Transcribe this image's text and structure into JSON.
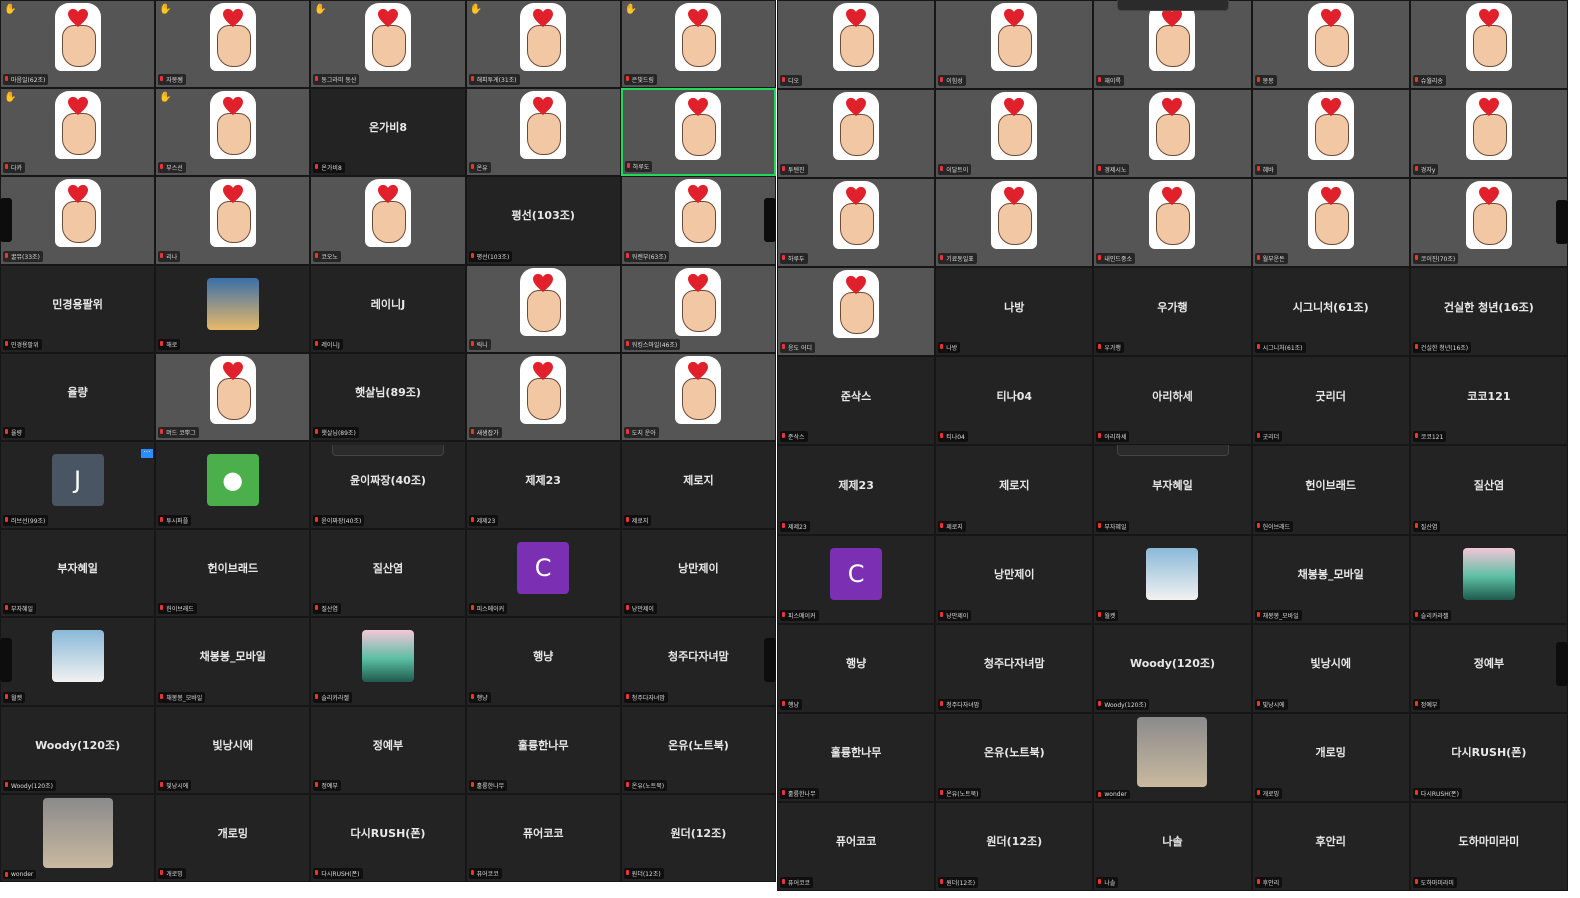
{
  "left_panel": {
    "tiles": [
      {
        "label": "마음일(62조)",
        "name": "",
        "video": true,
        "hand": true,
        "raised": true,
        "bg": "bg7"
      },
      {
        "label": "자몽쌤",
        "name": "",
        "video": true,
        "hand": true,
        "raised": true,
        "bg": "bg1"
      },
      {
        "label": "동그라미 동산",
        "name": "",
        "video": true,
        "hand": true,
        "raised": true,
        "bg": "bg7"
      },
      {
        "label": "해피투게(31조)",
        "name": "",
        "video": true,
        "hand": true,
        "raised": true,
        "bg": "bg2"
      },
      {
        "label": "은빛드림",
        "name": "",
        "video": true,
        "hand": true,
        "raised": true,
        "bg": "bg1"
      },
      {
        "label": "다카",
        "name": "",
        "video": true,
        "hand": true,
        "raised": true,
        "bg": "bg3"
      },
      {
        "label": "부스선",
        "name": "",
        "video": true,
        "hand": true,
        "raised": true,
        "bg": "bg3"
      },
      {
        "label": "온가비8",
        "name": "온가비8",
        "video": false
      },
      {
        "label": "온유",
        "name": "",
        "video": true,
        "hand": true,
        "bg": "bg7"
      },
      {
        "label": "하루도",
        "name": "",
        "video": true,
        "hand": true,
        "bg": "bg1",
        "active": true
      },
      {
        "label": "꿀뮤(33조)",
        "name": "",
        "video": true,
        "hand": true,
        "bg": "bg7"
      },
      {
        "label": "리나",
        "name": "",
        "video": true,
        "hand": true,
        "bg": "bg1"
      },
      {
        "label": "코오노",
        "name": "",
        "video": true,
        "hand": true,
        "bg": "bg7"
      },
      {
        "label": "평선(103조)",
        "name": "평선(103조)",
        "video": false
      },
      {
        "label": "워렌부(63조)",
        "name": "",
        "video": true,
        "hand": true,
        "bg": "bg6"
      },
      {
        "label": "민경용팔위",
        "name": "민경용팔위",
        "video": false
      },
      {
        "label": "해로",
        "name": "",
        "video": false,
        "avatar": "sunset"
      },
      {
        "label": "레이니J",
        "name": "레이니J",
        "video": false
      },
      {
        "label": "릭니",
        "name": "",
        "video": true,
        "hand": true,
        "bg": "bg1"
      },
      {
        "label": "워킹스마일(46조)",
        "name": "",
        "video": true,
        "hand": true,
        "bg": "bg7"
      },
      {
        "label": "율량",
        "name": "율량",
        "video": false
      },
      {
        "label": "머드 코뿌그",
        "name": "",
        "video": true,
        "hand": true,
        "bg": "bg7"
      },
      {
        "label": "햇살님(89조)",
        "name": "햇살님(89조)",
        "video": false
      },
      {
        "label": "새샘잡가",
        "name": "",
        "video": true,
        "hand": true,
        "bg": "bg7"
      },
      {
        "label": "도지 운아",
        "name": "",
        "video": true,
        "hand": true,
        "bg": "bg2"
      },
      {
        "label": "러브선(99조)",
        "name": "",
        "video": false,
        "avatar": "J"
      },
      {
        "label": "투시퍼플",
        "name": "",
        "video": false,
        "avatar": "user"
      },
      {
        "label": "윤이짜장(40조)",
        "name": "윤이짜장(40조)",
        "video": false
      },
      {
        "label": "제제23",
        "name": "제제23",
        "video": false
      },
      {
        "label": "제로지",
        "name": "제로지",
        "video": false
      },
      {
        "label": "부자혜일",
        "name": "부자혜일",
        "video": false
      },
      {
        "label": "헌이브래드",
        "name": "헌이브래드",
        "video": false
      },
      {
        "label": "질산염",
        "name": "질산염",
        "video": false
      },
      {
        "label": "피스메이커",
        "name": "",
        "video": false,
        "avatar": "C"
      },
      {
        "label": "낭만제이",
        "name": "낭만제이",
        "video": false
      },
      {
        "label": "월켓",
        "name": "",
        "video": false,
        "avatar": "pic"
      },
      {
        "label": "채봉봉_모바일",
        "name": "채봉봉_모바일",
        "video": false
      },
      {
        "label": "슬리카라젤",
        "name": "",
        "video": false,
        "avatar": "forest"
      },
      {
        "label": "행냥",
        "name": "행냥",
        "video": false
      },
      {
        "label": "청주다자녀맘",
        "name": "청주다자녀맘",
        "video": false
      },
      {
        "label": "Woody(120조)",
        "name": "Woody(120조)",
        "video": false
      },
      {
        "label": "빛낭시에",
        "name": "빛낭시에",
        "video": false
      },
      {
        "label": "정예부",
        "name": "정예부",
        "video": false
      },
      {
        "label": "훌륭한나무",
        "name": "훌륭한나무",
        "video": false
      },
      {
        "label": "온유(노트북)",
        "name": "온유(노트북)",
        "video": false
      },
      {
        "label": "wonder",
        "name": "",
        "video": false,
        "avatar": "stairs"
      },
      {
        "label": "개로밍",
        "name": "개로밍",
        "video": false
      },
      {
        "label": "다시RUSH(폰)",
        "name": "다시RUSH(폰)",
        "video": false
      },
      {
        "label": "퓨어코코",
        "name": "퓨어코코",
        "video": false
      },
      {
        "label": "원더(12조)",
        "name": "원더(12조)",
        "video": false
      }
    ],
    "more_button": "···"
  },
  "right_panel": {
    "tiles": [
      {
        "label": "디오",
        "name": "",
        "video": true,
        "hand": true,
        "bg": "bg1"
      },
      {
        "label": "이힘성",
        "name": "",
        "video": true,
        "hand": true,
        "bg": "bg4"
      },
      {
        "label": "재이륵",
        "name": "",
        "video": true,
        "hand": true,
        "bg": "bg5"
      },
      {
        "label": "몽몽",
        "name": "",
        "video": true,
        "hand": true,
        "bg": "bg7"
      },
      {
        "label": "슈월리송",
        "name": "",
        "video": true,
        "hand": true,
        "bg": "bg1"
      },
      {
        "label": "투텐진",
        "name": "",
        "video": true,
        "hand": true,
        "bg": "bg1"
      },
      {
        "label": "이달트이",
        "name": "",
        "video": true,
        "hand": true,
        "bg": "bg7"
      },
      {
        "label": "경제시노",
        "name": "",
        "video": true,
        "hand": true,
        "bg": "bg1"
      },
      {
        "label": "혜바",
        "name": "",
        "video": true,
        "hand": true,
        "bg": "bg7"
      },
      {
        "label": "경자y",
        "name": "",
        "video": true,
        "hand": true,
        "bg": "bg1"
      },
      {
        "label": "하루두",
        "name": "",
        "video": true,
        "hand": true,
        "bg": "bg3"
      },
      {
        "label": "기료동일표",
        "name": "",
        "video": true,
        "hand": true,
        "bg": "bg7"
      },
      {
        "label": "내인드중소",
        "name": "",
        "video": true,
        "hand": true,
        "bg": "bg1"
      },
      {
        "label": "월부운돈",
        "name": "",
        "video": true,
        "hand": true,
        "bg": "bg7"
      },
      {
        "label": "코이진(70조)",
        "name": "",
        "video": true,
        "hand": true,
        "bg": "bg3"
      },
      {
        "label": "응도 어디",
        "name": "",
        "video": true,
        "hand": true,
        "bg": "bg7"
      },
      {
        "label": "나방",
        "name": "나방",
        "video": false
      },
      {
        "label": "우가행",
        "name": "우가행",
        "video": false
      },
      {
        "label": "시그니처(61조)",
        "name": "시그니처(61조)",
        "video": false
      },
      {
        "label": "건실한 청년(16조)",
        "name": "건실한 청년(16조)",
        "video": false
      },
      {
        "label": "준삭스",
        "name": "준삭스",
        "video": false
      },
      {
        "label": "티나04",
        "name": "티나04",
        "video": false
      },
      {
        "label": "아리하세",
        "name": "아리하세",
        "video": false
      },
      {
        "label": "굿리더",
        "name": "굿리더",
        "video": false
      },
      {
        "label": "코코121",
        "name": "코코121",
        "video": false
      },
      {
        "label": "제제23",
        "name": "제제23",
        "video": false
      },
      {
        "label": "제로지",
        "name": "제로지",
        "video": false
      },
      {
        "label": "부자혜일",
        "name": "부자혜일",
        "video": false
      },
      {
        "label": "헌이브래드",
        "name": "헌이브래드",
        "video": false
      },
      {
        "label": "질산염",
        "name": "질산염",
        "video": false
      },
      {
        "label": "피스메이커",
        "name": "",
        "video": false,
        "avatar": "C"
      },
      {
        "label": "낭만제이",
        "name": "낭만제이",
        "video": false
      },
      {
        "label": "월켓",
        "name": "",
        "video": false,
        "avatar": "pic"
      },
      {
        "label": "채봉봉_모바일",
        "name": "채봉봉_모바일",
        "video": false
      },
      {
        "label": "슬리카라젤",
        "name": "",
        "video": false,
        "avatar": "forest"
      },
      {
        "label": "행냥",
        "name": "행냥",
        "video": false
      },
      {
        "label": "청주다자녀맘",
        "name": "청주다자녀맘",
        "video": false
      },
      {
        "label": "Woody(120조)",
        "name": "Woody(120조)",
        "video": false
      },
      {
        "label": "빛낭시에",
        "name": "빛낭시에",
        "video": false
      },
      {
        "label": "정예부",
        "name": "정예부",
        "video": false
      },
      {
        "label": "훌륭한나무",
        "name": "훌륭한나무",
        "video": false
      },
      {
        "label": "온유(노트북)",
        "name": "온유(노트북)",
        "video": false
      },
      {
        "label": "wonder",
        "name": "",
        "video": false,
        "avatar": "stairs"
      },
      {
        "label": "개로밍",
        "name": "개로밍",
        "video": false
      },
      {
        "label": "다시RUSH(폰)",
        "name": "다시RUSH(폰)",
        "video": false
      },
      {
        "label": "퓨어코코",
        "name": "퓨어코코",
        "video": false
      },
      {
        "label": "원더(12조)",
        "name": "원더(12조)",
        "video": false
      },
      {
        "label": "나솔",
        "name": "나솔",
        "video": false
      },
      {
        "label": "후안리",
        "name": "후안리",
        "video": false
      },
      {
        "label": "도하마미라미",
        "name": "도하마미라미",
        "video": false
      }
    ]
  },
  "colors": {
    "background": "#232323",
    "active_border": "#23d959",
    "mic_muted": "#e33333",
    "heart": "#e0202a",
    "accent": "#2d8cff"
  }
}
